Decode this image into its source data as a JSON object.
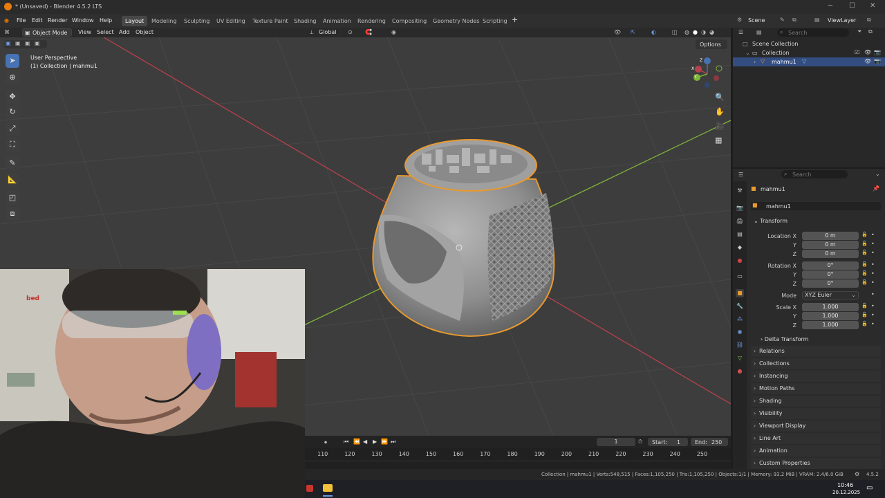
{
  "window": {
    "title": "* (Unsaved) - Blender 4.5.2 LTS"
  },
  "menu": [
    "File",
    "Edit",
    "Render",
    "Window",
    "Help"
  ],
  "workspaces": [
    "Layout",
    "Modeling",
    "Sculpting",
    "UV Editing",
    "Texture Paint",
    "Shading",
    "Animation",
    "Rendering",
    "Compositing",
    "Geometry Nodes",
    "Scripting"
  ],
  "active_workspace": "Layout",
  "scene": {
    "name": "Scene",
    "view_layer": "ViewLayer"
  },
  "viewport_header": {
    "mode": "Object Mode",
    "menus": [
      "View",
      "Select",
      "Add",
      "Object"
    ],
    "orientation": "Global",
    "options": "Options"
  },
  "viewport": {
    "perspective": "User Perspective",
    "context": "(1) Collection | mahmu1"
  },
  "gizmo": {
    "x": "X",
    "y": "Y",
    "z": "Z"
  },
  "outliner": {
    "search_placeholder": "Search",
    "scene_collection": "Scene Collection",
    "collection": "Collection",
    "object": "mahmu1"
  },
  "properties": {
    "search_placeholder": "Search",
    "object_title": "mahmu1",
    "object_name": "mahmu1",
    "transform_label": "Transform",
    "location_label": "Location X",
    "rotation_label": "Rotation X",
    "scale_label": "Scale X",
    "axis_y": "Y",
    "axis_z": "Z",
    "location": [
      "0 m",
      "0 m",
      "0 m"
    ],
    "rotation": [
      "0°",
      "0°",
      "0°"
    ],
    "scale": [
      "1.000",
      "1.000",
      "1.000"
    ],
    "mode_label": "Mode",
    "mode_value": "XYZ Euler",
    "delta_transform": "Delta Transform",
    "panels": [
      "Relations",
      "Collections",
      "Instancing",
      "Motion Paths",
      "Shading",
      "Visibility",
      "Viewport Display",
      "Line Art",
      "Animation",
      "Custom Properties"
    ]
  },
  "timeline": {
    "current_frame": "1",
    "start_label": "Start:",
    "start": "1",
    "end_label": "End:",
    "end": "250",
    "ruler": [
      "110",
      "120",
      "130",
      "140",
      "150",
      "160",
      "170",
      "180",
      "190",
      "200",
      "210",
      "220",
      "230",
      "240",
      "250"
    ]
  },
  "statusbar": {
    "text": "Collection | mahmu1 | Verts:548,515 | Faces:1,105,250 | Tris:1,105,250 | Objects:1/1 | Memory: 93.2 MiB | VRAM: 2.4/6.0 GiB",
    "version": "4.5.2"
  },
  "taskbar": {
    "time": "10:46",
    "date": "20.12.2025"
  },
  "webcam": {
    "sign_text": "bed"
  },
  "colors": {
    "accent": "#4772b3",
    "selection_outline": "#e8992f",
    "x_axis": "#b8414b",
    "y_axis": "#7fb53a"
  }
}
